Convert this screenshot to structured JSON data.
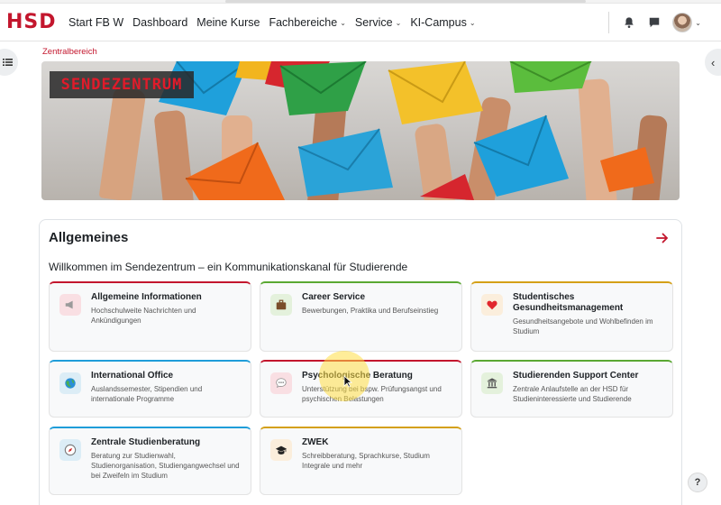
{
  "header": {
    "logo_text": "HSD",
    "nav": [
      {
        "label": "Start FB W",
        "dropdown": false
      },
      {
        "label": "Dashboard",
        "dropdown": false
      },
      {
        "label": "Meine Kurse",
        "dropdown": false
      },
      {
        "label": "Fachbereiche",
        "dropdown": true
      },
      {
        "label": "Service",
        "dropdown": true
      },
      {
        "label": "KI-Campus",
        "dropdown": true
      }
    ],
    "icons": [
      "bell-icon",
      "chat-icon",
      "avatar"
    ]
  },
  "breadcrumb": "Zentralbereich",
  "banner": {
    "title": "SENDEZENTRUM"
  },
  "section": {
    "title": "Allgemeines",
    "subtitle": "Willkommen im Sendezentrum – ein Kommunikationskanal für Studierende",
    "tiles": [
      {
        "name": "Allgemeine Informationen",
        "desc": "Hochschulweite Nachrichten und Ankündigungen",
        "icon": "megaphone-icon",
        "color": "#c3162d",
        "icon_bg": "#f9dfe3"
      },
      {
        "name": "Career Service",
        "desc": "Bewerbungen, Praktika und Berufseinstieg",
        "icon": "briefcase-icon",
        "color": "#5aa832",
        "icon_bg": "#e4f1dc"
      },
      {
        "name": "Studentisches Gesundheitsmanagement",
        "desc": "Gesundheitsangebote und Wohlbefinden im Studium",
        "icon": "heart-icon",
        "color": "#d4a017",
        "icon_bg": "#fbeedc"
      },
      {
        "name": "International Office",
        "desc": "Auslandssemester, Stipendien und internationale Programme",
        "icon": "globe-icon",
        "color": "#1f9dd9",
        "icon_bg": "#dcedf6"
      },
      {
        "name": "Psychologische Beratung",
        "desc": "Unterstützung bei bspw. Prüfungsangst und psychischen Belastungen",
        "icon": "speech-bubble-icon",
        "color": "#c3162d",
        "icon_bg": "#f9dfe3"
      },
      {
        "name": "Studierenden Support Center",
        "desc": "Zentrale Anlaufstelle an der HSD für Studieninteressierte und Studierende",
        "icon": "building-icon",
        "color": "#5aa832",
        "icon_bg": "#e4f1dc"
      },
      {
        "name": "Zentrale Studienberatung",
        "desc": "Beratung zur Studienwahl, Studienorganisation, Studiengangwechsel und bei Zweifeln im Studium",
        "icon": "compass-icon",
        "color": "#1f9dd9",
        "icon_bg": "#dcedf6"
      },
      {
        "name": "ZWEK",
        "desc": "Schreibberatung, Sprachkurse, Studium Integrale und mehr",
        "icon": "graduation-cap-icon",
        "color": "#d4a017",
        "icon_bg": "#fbeedc"
      }
    ]
  },
  "help_label": "?"
}
